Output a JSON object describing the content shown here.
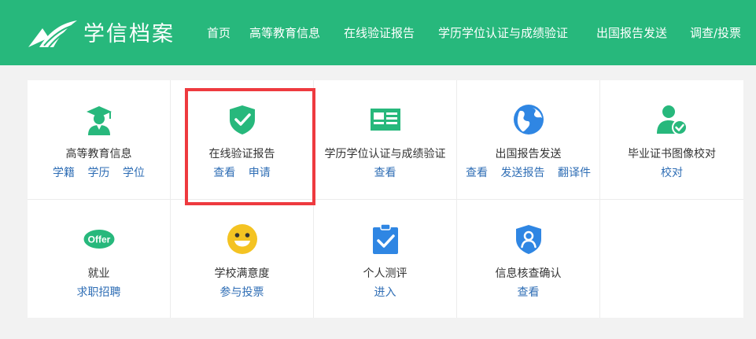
{
  "header": {
    "brand": "学信档案",
    "nav": [
      {
        "label": "首页"
      },
      {
        "label": "高等教育信息"
      },
      {
        "label": "在线验证报告"
      },
      {
        "label": "学历学位认证与成绩验证"
      },
      {
        "label": "出国报告发送"
      },
      {
        "label": "调查/投票"
      }
    ]
  },
  "colors": {
    "brand_green": "#27b87c",
    "link_blue": "#2f6eb5",
    "highlight_red": "#ee3a3f"
  },
  "tiles": [
    {
      "title": "高等教育信息",
      "icon": "graduate-icon",
      "links": [
        "学籍",
        "学历",
        "学位"
      ]
    },
    {
      "title": "在线验证报告",
      "icon": "shield-check-icon",
      "links": [
        "查看",
        "申请"
      ]
    },
    {
      "title": "学历学位认证与成绩验证",
      "icon": "id-card-icon",
      "links": [
        "查看"
      ]
    },
    {
      "title": "出国报告发送",
      "icon": "globe-icon",
      "links": [
        "查看",
        "发送报告",
        "翻译件"
      ]
    },
    {
      "title": "毕业证书图像校对",
      "icon": "user-check-icon",
      "links": [
        "校对"
      ]
    },
    {
      "title": "就业",
      "icon": "offer-badge-icon",
      "icon_text": "Offer",
      "links": [
        "求职招聘"
      ]
    },
    {
      "title": "学校满意度",
      "icon": "smiley-icon",
      "links": [
        "参与投票"
      ]
    },
    {
      "title": "个人测评",
      "icon": "clipboard-check-icon",
      "links": [
        "进入"
      ]
    },
    {
      "title": "信息核查确认",
      "icon": "shield-user-icon",
      "links": [
        "查看"
      ]
    }
  ]
}
